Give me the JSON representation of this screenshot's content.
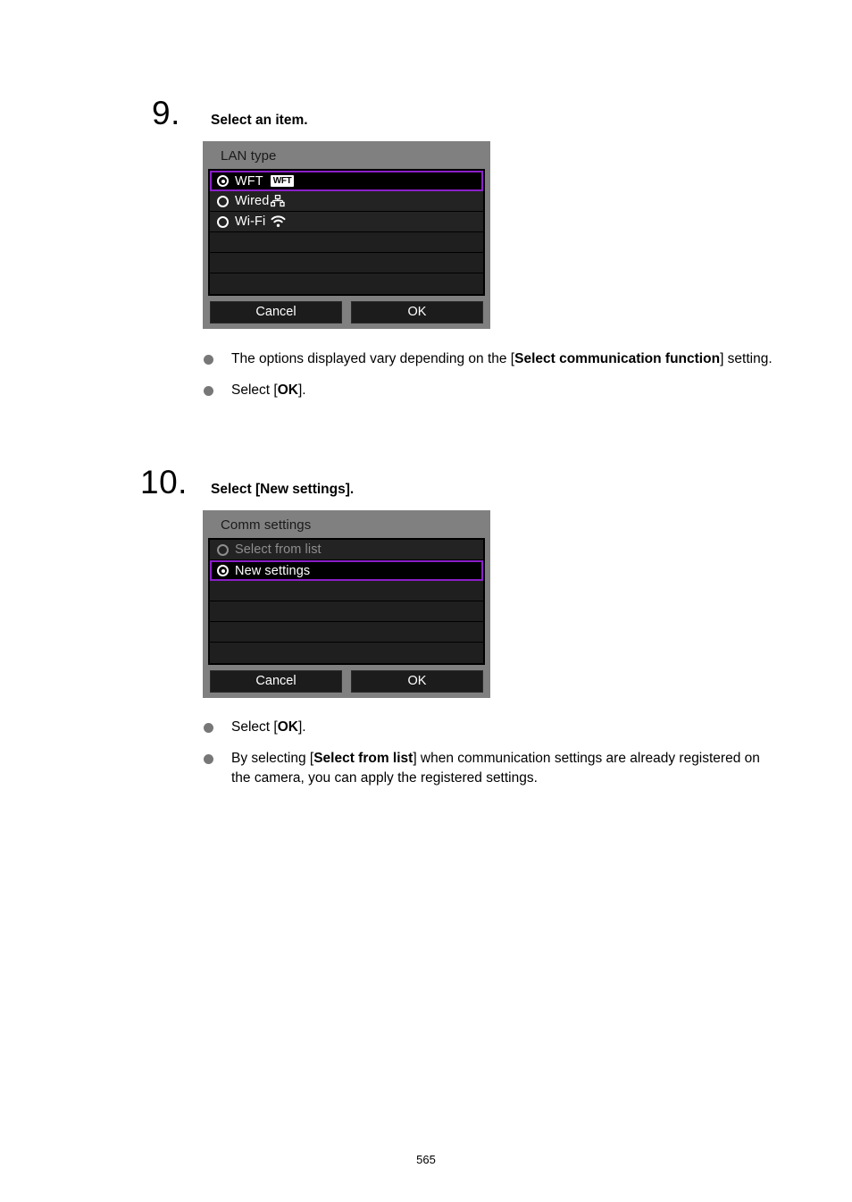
{
  "document": {
    "page_number": "565"
  },
  "steps": [
    {
      "number": "9.",
      "title": "Select an item.",
      "screen": {
        "title": "LAN type",
        "rows": [
          {
            "label": "WFT",
            "radio": "selected",
            "highlighted": true,
            "badge": "WFT",
            "icon": "",
            "disabled": false
          },
          {
            "label": "Wired",
            "radio": "unselected",
            "highlighted": false,
            "badge": "",
            "icon": "wired-lan-icon",
            "disabled": false
          },
          {
            "label": "Wi-Fi",
            "radio": "unselected",
            "highlighted": false,
            "badge": "",
            "icon": "wifi-signal-icon",
            "disabled": false
          },
          {
            "label": "",
            "radio": "none",
            "highlighted": false,
            "badge": "",
            "icon": "",
            "disabled": false
          },
          {
            "label": "",
            "radio": "none",
            "highlighted": false,
            "badge": "",
            "icon": "",
            "disabled": false
          },
          {
            "label": "",
            "radio": "none",
            "highlighted": false,
            "badge": "",
            "icon": "",
            "disabled": false
          }
        ],
        "cancel_label": "Cancel",
        "ok_label": "OK"
      },
      "bullets": [
        {
          "parts": [
            {
              "text": "The options displayed vary depending on the [",
              "bold": false
            },
            {
              "text": "Select communication function",
              "bold": true
            },
            {
              "text": "] setting.",
              "bold": false
            }
          ]
        },
        {
          "parts": [
            {
              "text": "Select [",
              "bold": false
            },
            {
              "text": "OK",
              "bold": true
            },
            {
              "text": "].",
              "bold": false
            }
          ]
        }
      ]
    },
    {
      "number": "10.",
      "title": "Select [New settings].",
      "screen": {
        "title": "Comm settings",
        "rows": [
          {
            "label": "Select from list",
            "radio": "unselected",
            "highlighted": false,
            "badge": "",
            "icon": "",
            "disabled": true
          },
          {
            "label": "New settings",
            "radio": "selected",
            "highlighted": true,
            "badge": "",
            "icon": "",
            "disabled": false
          },
          {
            "label": "",
            "radio": "none",
            "highlighted": false,
            "badge": "",
            "icon": "",
            "disabled": false
          },
          {
            "label": "",
            "radio": "none",
            "highlighted": false,
            "badge": "",
            "icon": "",
            "disabled": false
          },
          {
            "label": "",
            "radio": "none",
            "highlighted": false,
            "badge": "",
            "icon": "",
            "disabled": false
          },
          {
            "label": "",
            "radio": "none",
            "highlighted": false,
            "badge": "",
            "icon": "",
            "disabled": false
          }
        ],
        "cancel_label": "Cancel",
        "ok_label": "OK"
      },
      "bullets": [
        {
          "parts": [
            {
              "text": "Select [",
              "bold": false
            },
            {
              "text": "OK",
              "bold": true
            },
            {
              "text": "].",
              "bold": false
            }
          ]
        },
        {
          "parts": [
            {
              "text": "By selecting [",
              "bold": false
            },
            {
              "text": "Select from list",
              "bold": true
            },
            {
              "text": "] when communication settings are already registered on the camera, you can apply the registered settings.",
              "bold": false
            }
          ]
        }
      ]
    }
  ],
  "colors": {
    "highlight_purple": "#8a1fc8",
    "screen_background": "#808080",
    "list_background": "#232323",
    "selected_row_background": "#000000",
    "bullet_dot": "#777777"
  }
}
